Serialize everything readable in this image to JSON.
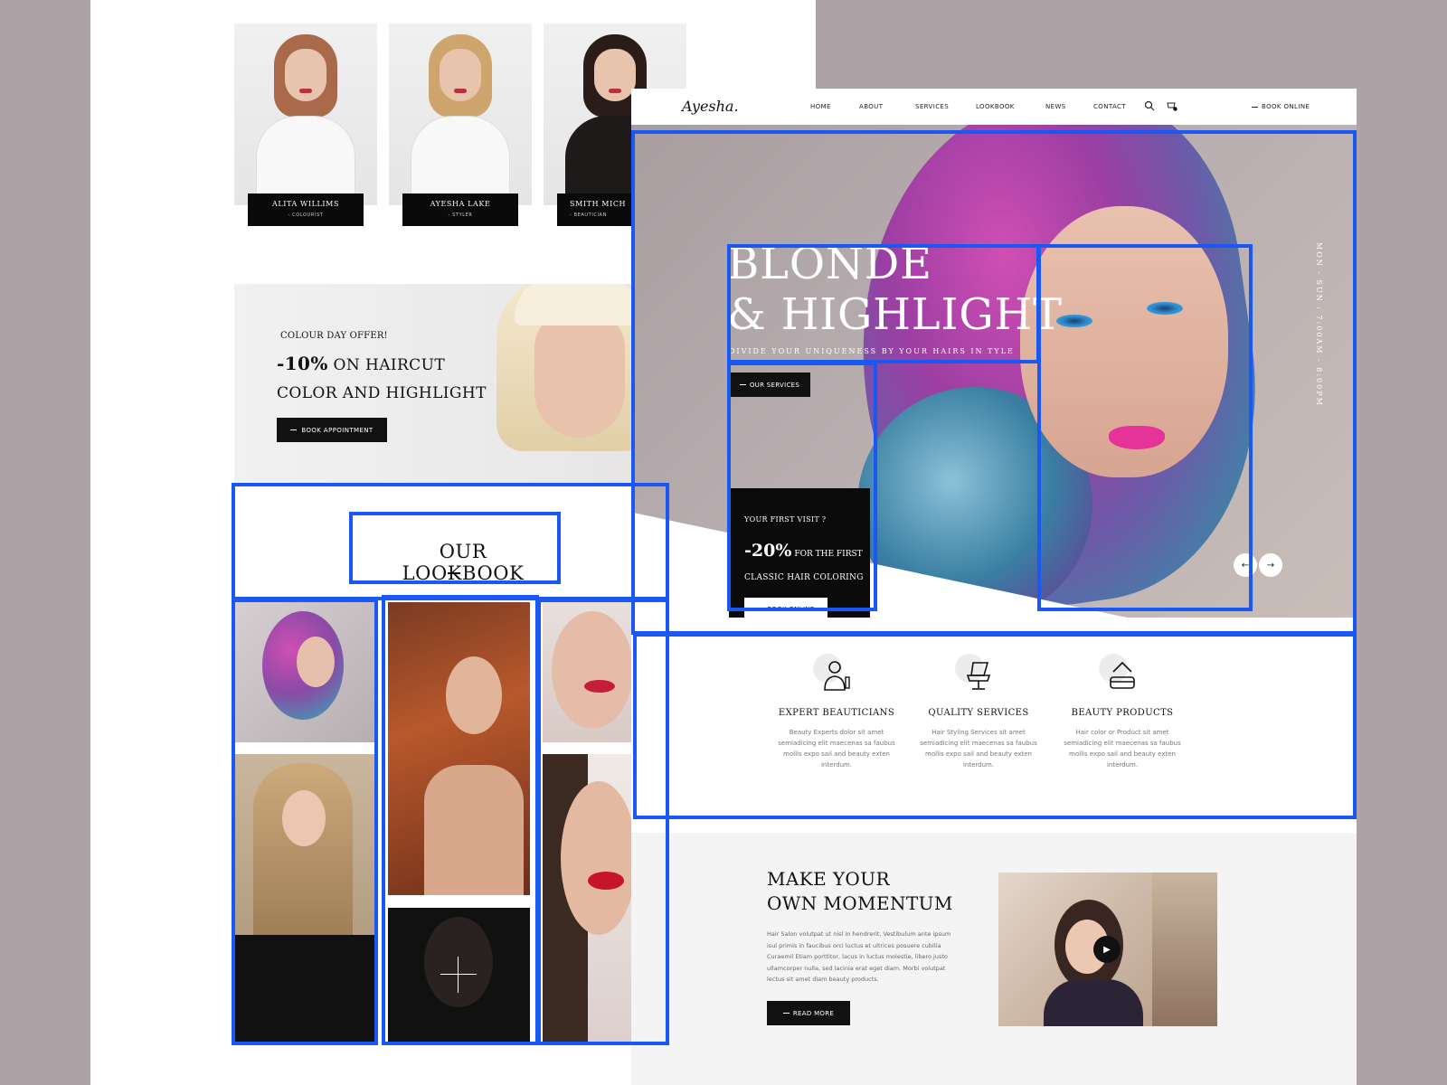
{
  "team": [
    {
      "name": "ALITA WILLIMS",
      "role": "- COLOURIST",
      "hair": "#a9694a"
    },
    {
      "name": "AYESHA LAKE",
      "role": "- STYLER",
      "hair": "#cda56d"
    },
    {
      "name": "SMITH MICH",
      "role": "- BEAUTICIAN",
      "hair": "#2a1d19"
    }
  ],
  "offer": {
    "small": "COLOUR DAY OFFER!",
    "discount": "-10%",
    "line1_rest": " ON HAIRCUT",
    "line2": "COLOR AND HIGHLIGHT",
    "button": "BOOK APPOINTMENT"
  },
  "lookbook": {
    "title": "OUR LOOKBOOK",
    "add_icon": "plus-icon"
  },
  "nav": {
    "logo": "Ayesha.",
    "items": [
      "HOME",
      "ABOUT",
      "SERVICES",
      "LOOKBOOK",
      "NEWS",
      "CONTACT"
    ],
    "book_online": "BOOK ONLINE"
  },
  "hero": {
    "title_line1": "BLONDE",
    "title_line2": "& HIGHLIGHT",
    "subtitle": "DIVIDE YOUR UNIQUENESS BY YOUR HAIRS IN TYLE",
    "services_button": "OUR SERVICES",
    "schedule": "MON - SUN : 7:00AM - 8:00PM",
    "prev_icon": "arrow-left-icon",
    "next_icon": "arrow-right-icon"
  },
  "first_visit": {
    "question": "YOUR FIRST VISIT ?",
    "discount": "-20%",
    "discount_rest": "FOR THE FIRST",
    "service": "CLASSIC HAIR COLORING",
    "button": "BOOK ONLINE"
  },
  "features": [
    {
      "title": "EXPERT BEAUTICIANS",
      "desc": "Beauty Experts dolor sit amet semiadicing elit maecenas sa faubus mollis expo sail and beauty exten interdum.",
      "icon": "beautician-icon"
    },
    {
      "title": "QUALITY SERVICES",
      "desc": "Hair Styling Services sit amet semiadicing elit maecenas sa faubus mollis expo sail and beauty exten interdum.",
      "icon": "salon-chair-icon"
    },
    {
      "title": "BEAUTY PRODUCTS",
      "desc": "Hair color or Product sit amet semiadicing elit maecenas sa faubus mollis expo sail and beauty exten interdum.",
      "icon": "cosmetics-icon"
    }
  ],
  "momentum": {
    "title_line1": "MAKE YOUR",
    "title_line2": "OWN MOMENTUM",
    "text": "Hair Salon volutpat ut nisl in hendrerit. Vestibulum ante ipsum isul primis in faucibus orci luctus et ultrices posuere cubilia Curaemil Etiam porttitor, lacus in luctus molestie, libero justo ullamcorper nulla, sed lacinia erat eget diam. Morbi volutpat lectus sit amet diam beauty products.",
    "button": "READ MORE",
    "play_icon": "play-icon"
  },
  "colors": {
    "background": "#ada3a6",
    "accent_dark": "#0b0b0b",
    "highlight": "#1a58f3"
  }
}
